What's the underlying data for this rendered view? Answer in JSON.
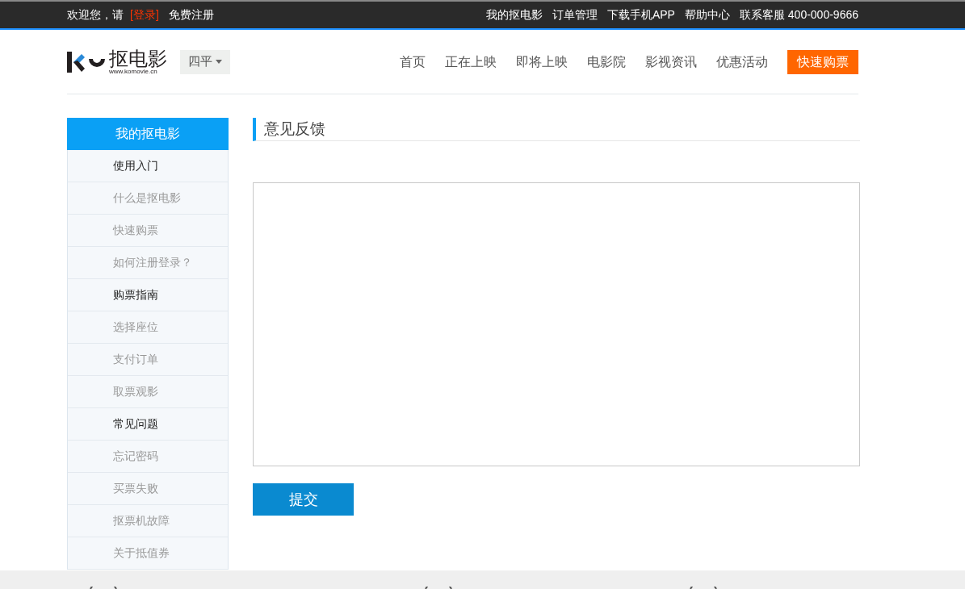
{
  "top_bar": {
    "greeting": "欢迎您，请",
    "login_link": "[登录]",
    "register_link": "免费注册",
    "links": [
      "我的抠电影",
      "订单管理",
      "下载手机APP",
      "帮助中心"
    ],
    "hotline": "联系客服 400-000-9666"
  },
  "header": {
    "logo_text": "抠电影",
    "logo_url": "www.komovie.cn",
    "city": "四平",
    "nav": [
      "首页",
      "正在上映",
      "即将上映",
      "电影院",
      "影视资讯",
      "优惠活动"
    ],
    "cta": "快速购票"
  },
  "sidebar": {
    "title": "我的抠电影",
    "items": [
      {
        "kind": "heading",
        "label": "使用入门"
      },
      {
        "kind": "link",
        "label": "什么是抠电影"
      },
      {
        "kind": "link",
        "label": "快速购票"
      },
      {
        "kind": "link",
        "label": "如何注册登录？"
      },
      {
        "kind": "heading",
        "label": "购票指南"
      },
      {
        "kind": "link",
        "label": "选择座位"
      },
      {
        "kind": "link",
        "label": "支付订单"
      },
      {
        "kind": "link",
        "label": "取票观影"
      },
      {
        "kind": "heading",
        "label": "常见问题"
      },
      {
        "kind": "link",
        "label": "忘记密码"
      },
      {
        "kind": "link",
        "label": "买票失败"
      },
      {
        "kind": "link",
        "label": "抠票机故障"
      },
      {
        "kind": "link",
        "label": "关于抵值券"
      }
    ]
  },
  "main": {
    "title": "意见反馈",
    "submit": "提交"
  }
}
